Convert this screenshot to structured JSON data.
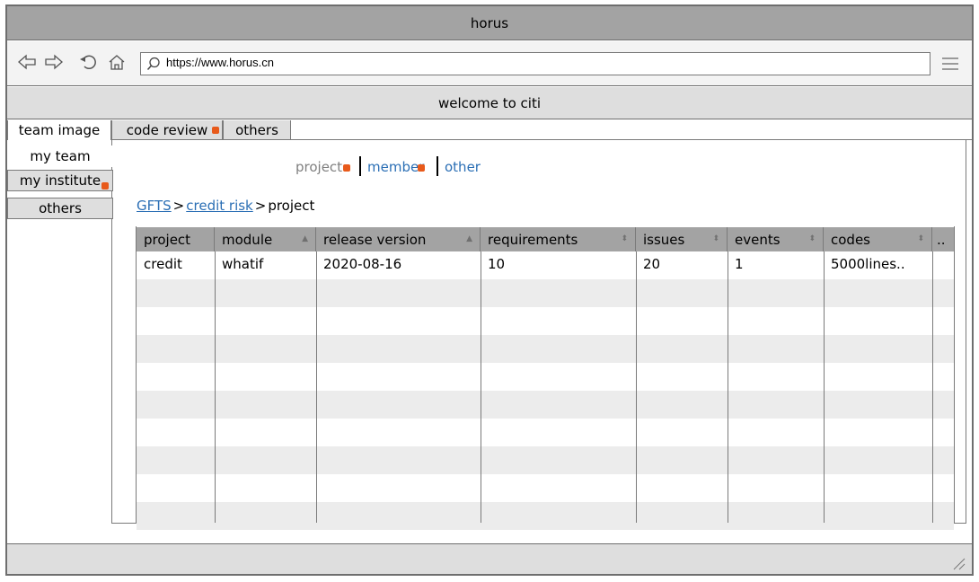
{
  "window": {
    "title": "horus"
  },
  "browser": {
    "url": "https://www.horus.cn",
    "icons": [
      "back-icon",
      "forward-icon",
      "refresh-icon",
      "home-icon",
      "search-icon",
      "menu-icon"
    ]
  },
  "banner": {
    "text": "welcome to citi"
  },
  "tabs": [
    {
      "label": "team image",
      "active": true
    },
    {
      "label": "code review",
      "active": false
    },
    {
      "label": "others",
      "active": false
    }
  ],
  "sidebar": {
    "items": [
      {
        "label": "my team",
        "active": true
      },
      {
        "label": "my institute",
        "active": false
      },
      {
        "label": "others",
        "active": false
      }
    ]
  },
  "subnav": {
    "items": [
      {
        "label": "project",
        "color": "#808080"
      },
      {
        "label": "member",
        "color": "#2b6fb5"
      },
      {
        "label": "other",
        "color": "#2b6fb5"
      }
    ]
  },
  "breadcrumb": {
    "items": [
      "GFTS",
      "credit risk",
      "project"
    ],
    "separator": ">"
  },
  "table": {
    "columns": [
      "project",
      "module",
      "release version",
      "requirements",
      "issues",
      "events",
      "codes",
      ".."
    ],
    "rows": [
      [
        "credit",
        "whatif",
        "2020-08-16",
        "10",
        "20",
        "1",
        "5000lines..",
        ""
      ]
    ]
  },
  "colors": {
    "accent_marker": "#e85a1b",
    "link": "#2b6fb5",
    "title_bar": "#a3a3a3",
    "panel_gray": "#dedede"
  }
}
